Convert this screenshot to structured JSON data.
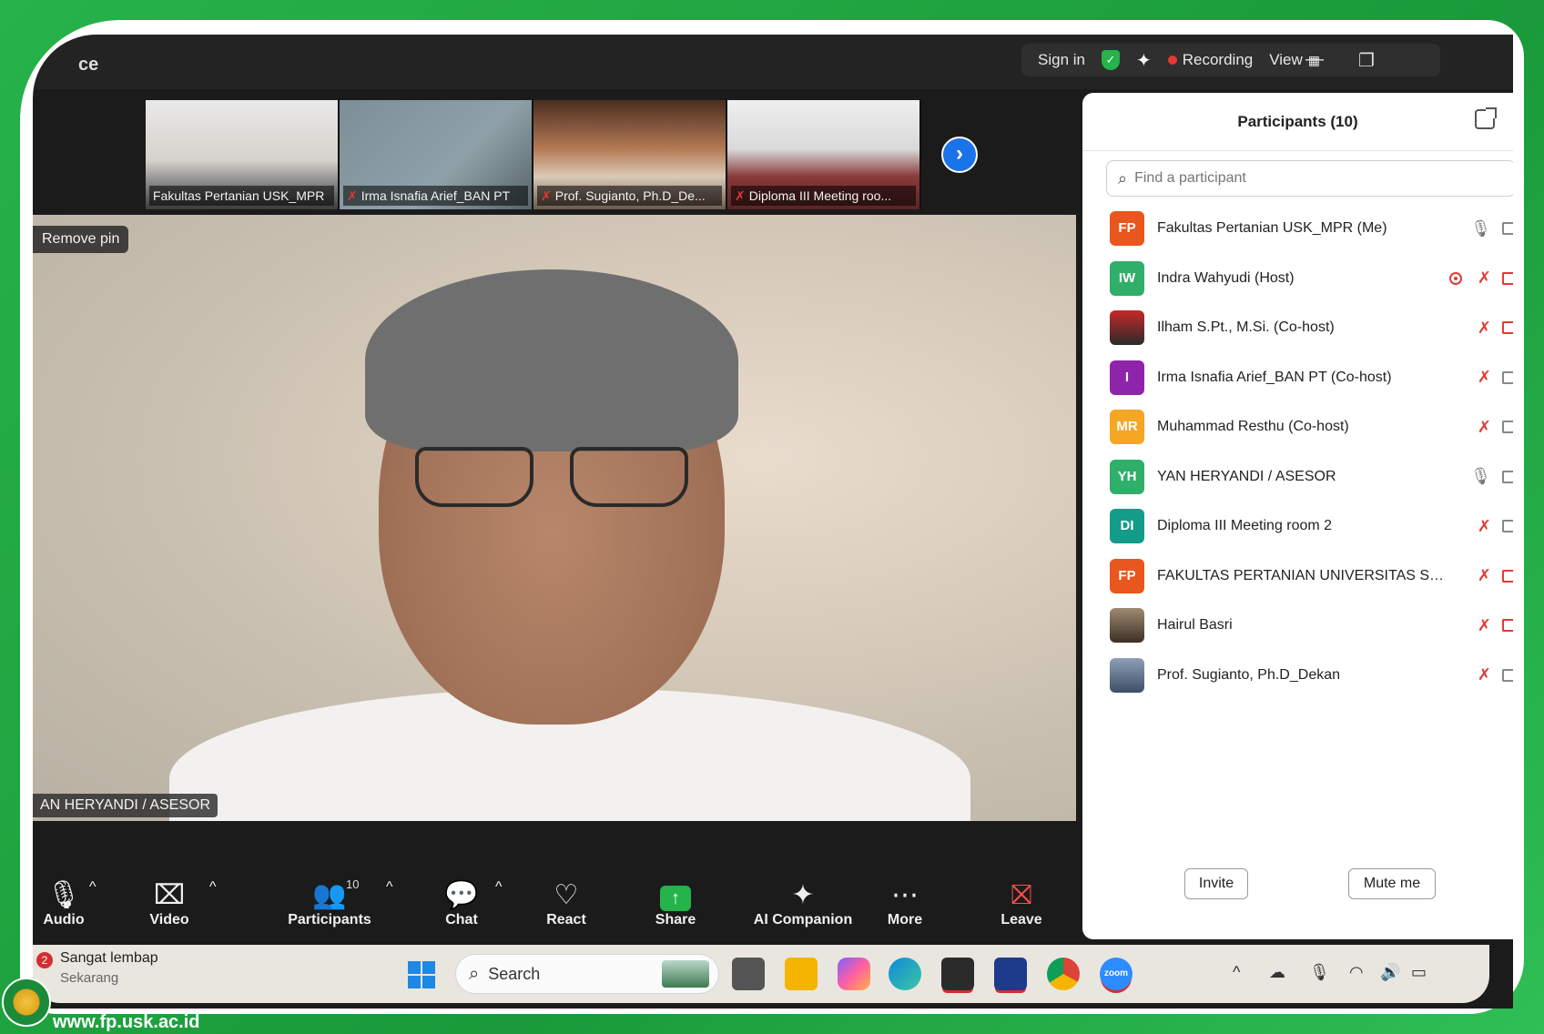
{
  "title_bar": {
    "app_title": "ce",
    "sign_in": "Sign in",
    "recording": "Recording",
    "view": "View"
  },
  "thumbnails": [
    {
      "name": "Fakultas Pertanian USK_MPR",
      "muted": false
    },
    {
      "name": "Irma Isnafia Arief_BAN PT",
      "muted": true
    },
    {
      "name": "Prof. Sugianto, Ph.D_De...",
      "muted": true
    },
    {
      "name": "Diploma III Meeting roo...",
      "muted": true
    }
  ],
  "main_video": {
    "remove_pin": "Remove pin",
    "speaker_name": "AN HERYANDI / ASESOR"
  },
  "toolbar": {
    "audio": "Audio",
    "video": "Video",
    "participants": "Participants",
    "participants_count": "10",
    "chat": "Chat",
    "react": "React",
    "share": "Share",
    "ai_companion": "AI Companion",
    "more": "More",
    "leave": "Leave"
  },
  "participants_panel": {
    "title": "Participants (10)",
    "search_placeholder": "Find a participant",
    "participants": [
      {
        "initials": "FP",
        "color": "#e8571e",
        "name": "Fakultas Pertanian USK_MPR (Me)",
        "mic": "on",
        "video": "on"
      },
      {
        "initials": "IW",
        "color": "#2faf6a",
        "name": "Indra Wahyudi (Host)",
        "mic": "muted",
        "video": "off",
        "recording": true
      },
      {
        "initials": "",
        "color": "#c62828",
        "name": "Ilham S.Pt., M.Si. (Co-host)",
        "mic": "muted",
        "video": "off",
        "photo": true
      },
      {
        "initials": "I",
        "color": "#8e24aa",
        "name": "Irma Isnafia Arief_BAN PT (Co-host)",
        "mic": "muted",
        "video": "on"
      },
      {
        "initials": "MR",
        "color": "#f5a623",
        "name": "Muhammad Resthu (Co-host)",
        "mic": "muted",
        "video": "on"
      },
      {
        "initials": "YH",
        "color": "#2faf6a",
        "name": "YAN HERYANDI / ASESOR",
        "mic": "on",
        "video": "on"
      },
      {
        "initials": "DI",
        "color": "#139c8a",
        "name": "Diploma III Meeting room 2",
        "mic": "muted",
        "video": "on"
      },
      {
        "initials": "FP",
        "color": "#e8571e",
        "name": "FAKULTAS PERTANIAN UNIVERSITAS SYIHA...",
        "mic": "muted",
        "video": "off"
      },
      {
        "initials": "",
        "color": "#6d5b4a",
        "name": "Hairul Basri",
        "mic": "muted",
        "video": "off",
        "photo": true
      },
      {
        "initials": "",
        "color": "#3d4e66",
        "name": "Prof. Sugianto, Ph.D_Dekan",
        "mic": "muted",
        "video": "on",
        "photo": true
      }
    ],
    "invite": "Invite",
    "mute_me": "Mute me"
  },
  "taskbar": {
    "notification_count": "2",
    "notification_title": "Sangat lembap",
    "notification_sub": "Sekarang",
    "search_label": "Search"
  },
  "footer": {
    "url": "www.fp.usk.ac.id"
  }
}
